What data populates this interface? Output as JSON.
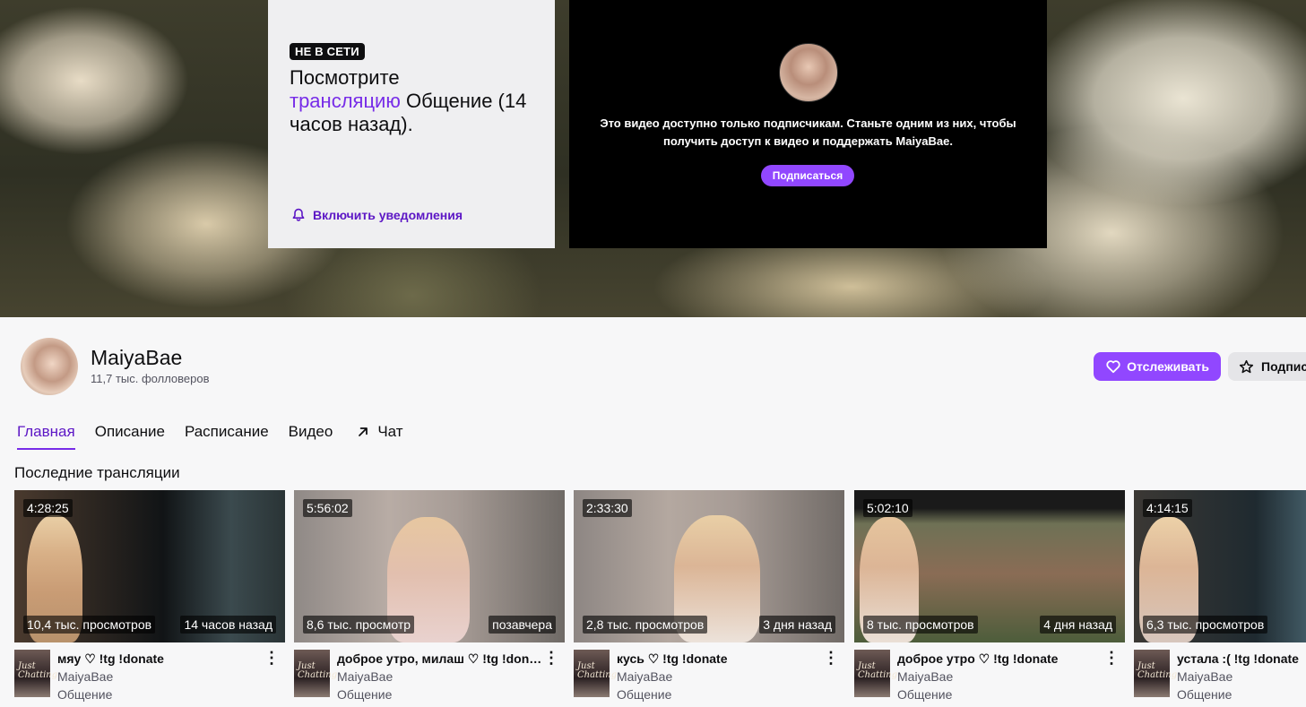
{
  "banner": {
    "offline_badge": "НЕ В СЕТИ",
    "watch_prefix": "Посмотрите",
    "watch_link": "трансляцию",
    "watch_suffix": "Общение (14 часов назад).",
    "notify_label": "Включить уведомления",
    "player_message_line1": "Это видео доступно только подписчикам. Станьте одним из них, чтобы",
    "player_message_line2": "получить доступ к видео и поддержать MaiyaBae.",
    "subscribe_label": "Подписаться"
  },
  "channel": {
    "name": "MaiyaBae",
    "followers": "11,7 тыс. фолловеров",
    "follow_label": "Отслеживать",
    "subscribe_label": "Подпис"
  },
  "tabs": [
    {
      "label": "Главная",
      "active": true
    },
    {
      "label": "Описание"
    },
    {
      "label": "Расписание"
    },
    {
      "label": "Видео"
    },
    {
      "label": "Чат",
      "icon": "arrow-up-right-icon"
    }
  ],
  "section_title": "Последние трансляции",
  "videos": [
    {
      "duration": "4:28:25",
      "views": "10,4 тыс. просмотров",
      "ago": "14 часов назад",
      "title": "мяу ♡ !tg !donate",
      "channel": "MaiyaBae",
      "category": "Общение"
    },
    {
      "duration": "5:56:02",
      "views": "8,6 тыс. просмотр",
      "ago": "позавчера",
      "title": "доброе утро, милаш ♡ !tg !donate",
      "channel": "MaiyaBae",
      "category": "Общение"
    },
    {
      "duration": "2:33:30",
      "views": "2,8 тыс. просмотров",
      "ago": "3 дня назад",
      "title": "кусь ♡ !tg !donate",
      "channel": "MaiyaBae",
      "category": "Общение"
    },
    {
      "duration": "5:02:10",
      "views": "8 тыс. просмотров",
      "ago": "4 дня назад",
      "title": "доброе утро ♡ !tg !donate",
      "channel": "MaiyaBae",
      "category": "Общение"
    },
    {
      "duration": "4:14:15",
      "views": "6,3 тыс. просмотров",
      "ago": "",
      "title": "устала :( !tg !donate",
      "channel": "MaiyaBae",
      "category": "Общение"
    }
  ],
  "colors": {
    "accent": "#9147ff",
    "accent_text": "#772ce8"
  }
}
